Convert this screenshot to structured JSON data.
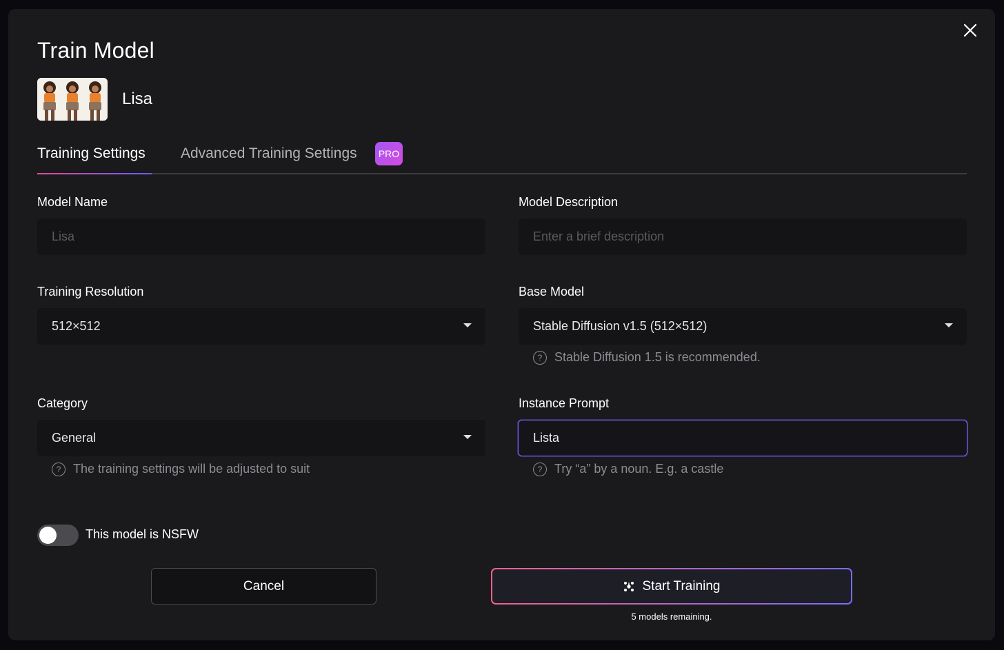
{
  "modal": {
    "title": "Train Model",
    "model_header_name": "Lisa"
  },
  "tabs": [
    {
      "label": "Training Settings",
      "active": true
    },
    {
      "label": "Advanced Training Settings",
      "badge": "PRO",
      "active": false
    }
  ],
  "fields": {
    "model_name": {
      "label": "Model Name",
      "placeholder": "Lisa"
    },
    "model_description": {
      "label": "Model Description",
      "placeholder": "Enter a brief description"
    },
    "training_resolution": {
      "label": "Training Resolution",
      "value": "512×512"
    },
    "base_model": {
      "label": "Base Model",
      "value": "Stable Diffusion v1.5 (512×512)",
      "hint": "Stable Diffusion 1.5 is recommended."
    },
    "category": {
      "label": "Category",
      "value": "General",
      "hint": "The training settings will be adjusted to suit"
    },
    "instance_prompt": {
      "label": "Instance Prompt",
      "value": "Lista",
      "hint": "Try “a” by a noun. E.g. a castle"
    }
  },
  "nsfw_toggle": {
    "label": "This model is NSFW",
    "on": false
  },
  "actions": {
    "cancel_label": "Cancel",
    "start_label": "Start Training",
    "remaining_text": "5 models remaining."
  },
  "colors": {
    "modal_bg": "#1a1a1c",
    "field_bg": "#141416",
    "focus_border": "#7a62ff",
    "gradient_start": "#f2628f",
    "gradient_end": "#7a6bff",
    "pro_badge": "#b553ec"
  },
  "icons": {
    "close": "close-icon",
    "help": "help-circle-icon",
    "dropdown": "chevron-down-icon",
    "start": "sparkle-icon"
  }
}
